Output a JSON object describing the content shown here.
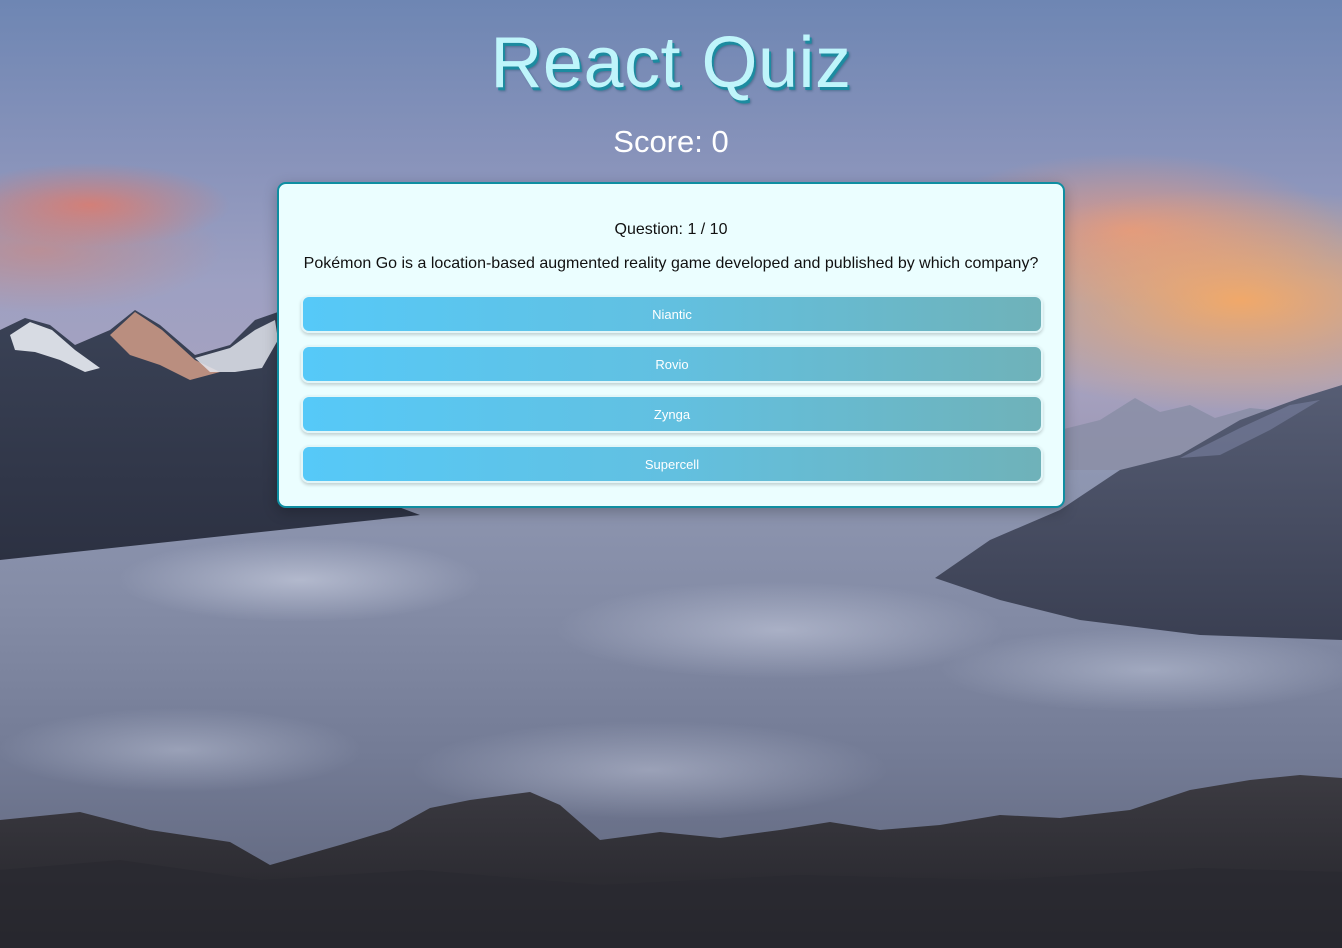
{
  "app": {
    "title": "React Quiz",
    "score_text": "Score: 0"
  },
  "question": {
    "progress_text": "Question: 1 / 10",
    "text": "Pokémon Go is a location-based augmented reality game developed and published by which company?"
  },
  "answers": [
    {
      "label": "Niantic"
    },
    {
      "label": "Rovio"
    },
    {
      "label": "Zynga"
    },
    {
      "label": "Supercell"
    }
  ],
  "colors": {
    "title": "#bff5fb",
    "title_shadow": "#1c8ba0",
    "card_background": "#ebfeff",
    "card_border": "#0f8ea1",
    "answer_gradient_start": "#56c9f8",
    "answer_gradient_end": "#6fb2b9"
  }
}
